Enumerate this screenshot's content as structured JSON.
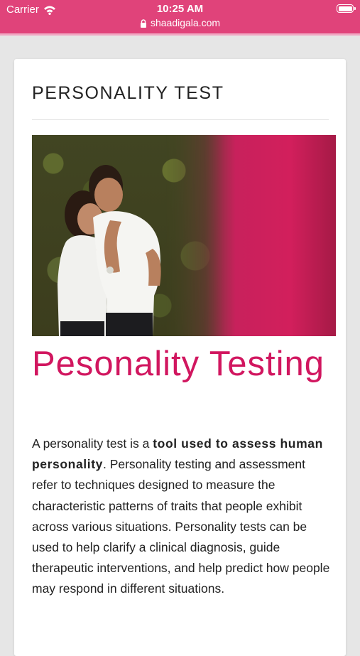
{
  "status_bar": {
    "carrier": "Carrier",
    "time": "10:25 AM",
    "url": "shaadigala.com",
    "background": "#e0437a"
  },
  "card": {
    "title": "PERSONALITY TEST"
  },
  "hero": {
    "description": "couple photo",
    "accent": "#d21f5c"
  },
  "article": {
    "heading": "Pesonality Testing",
    "heading_color": "#d1165f",
    "intro": "A personality test is a ",
    "bold": "tool used to assess human personality",
    "rest": ". Personality testing and assessment refer to techniques designed to measure the characteristic patterns of traits that people exhibit across various situations. Personality tests can be used to help clarify a clinical diagnosis, guide therapeutic interventions, and help predict how people may respond in different situations."
  },
  "icons": [
    "wifi-icon",
    "lock-icon",
    "battery-icon"
  ]
}
